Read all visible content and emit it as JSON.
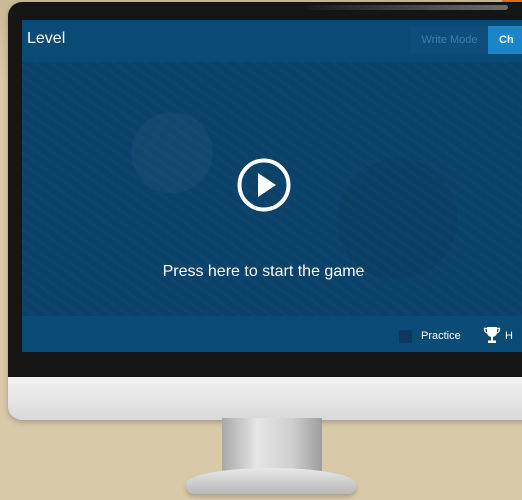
{
  "header": {
    "title": "Level",
    "tabs": [
      {
        "label": "Write Mode"
      },
      {
        "label": "Ch"
      }
    ]
  },
  "game": {
    "start_label": "Press here to start the game",
    "play_icon": "play-circle-icon"
  },
  "footer": {
    "practice_label": "Practice",
    "trophy_icon": "trophy-icon",
    "h_label": "H"
  },
  "colors": {
    "screen_bg": "#0b426a",
    "bar_bg": "#0a4a77",
    "active_tab": "#1a86c8",
    "page_bg": "#d8c9a9",
    "accent": "#e0701f"
  }
}
